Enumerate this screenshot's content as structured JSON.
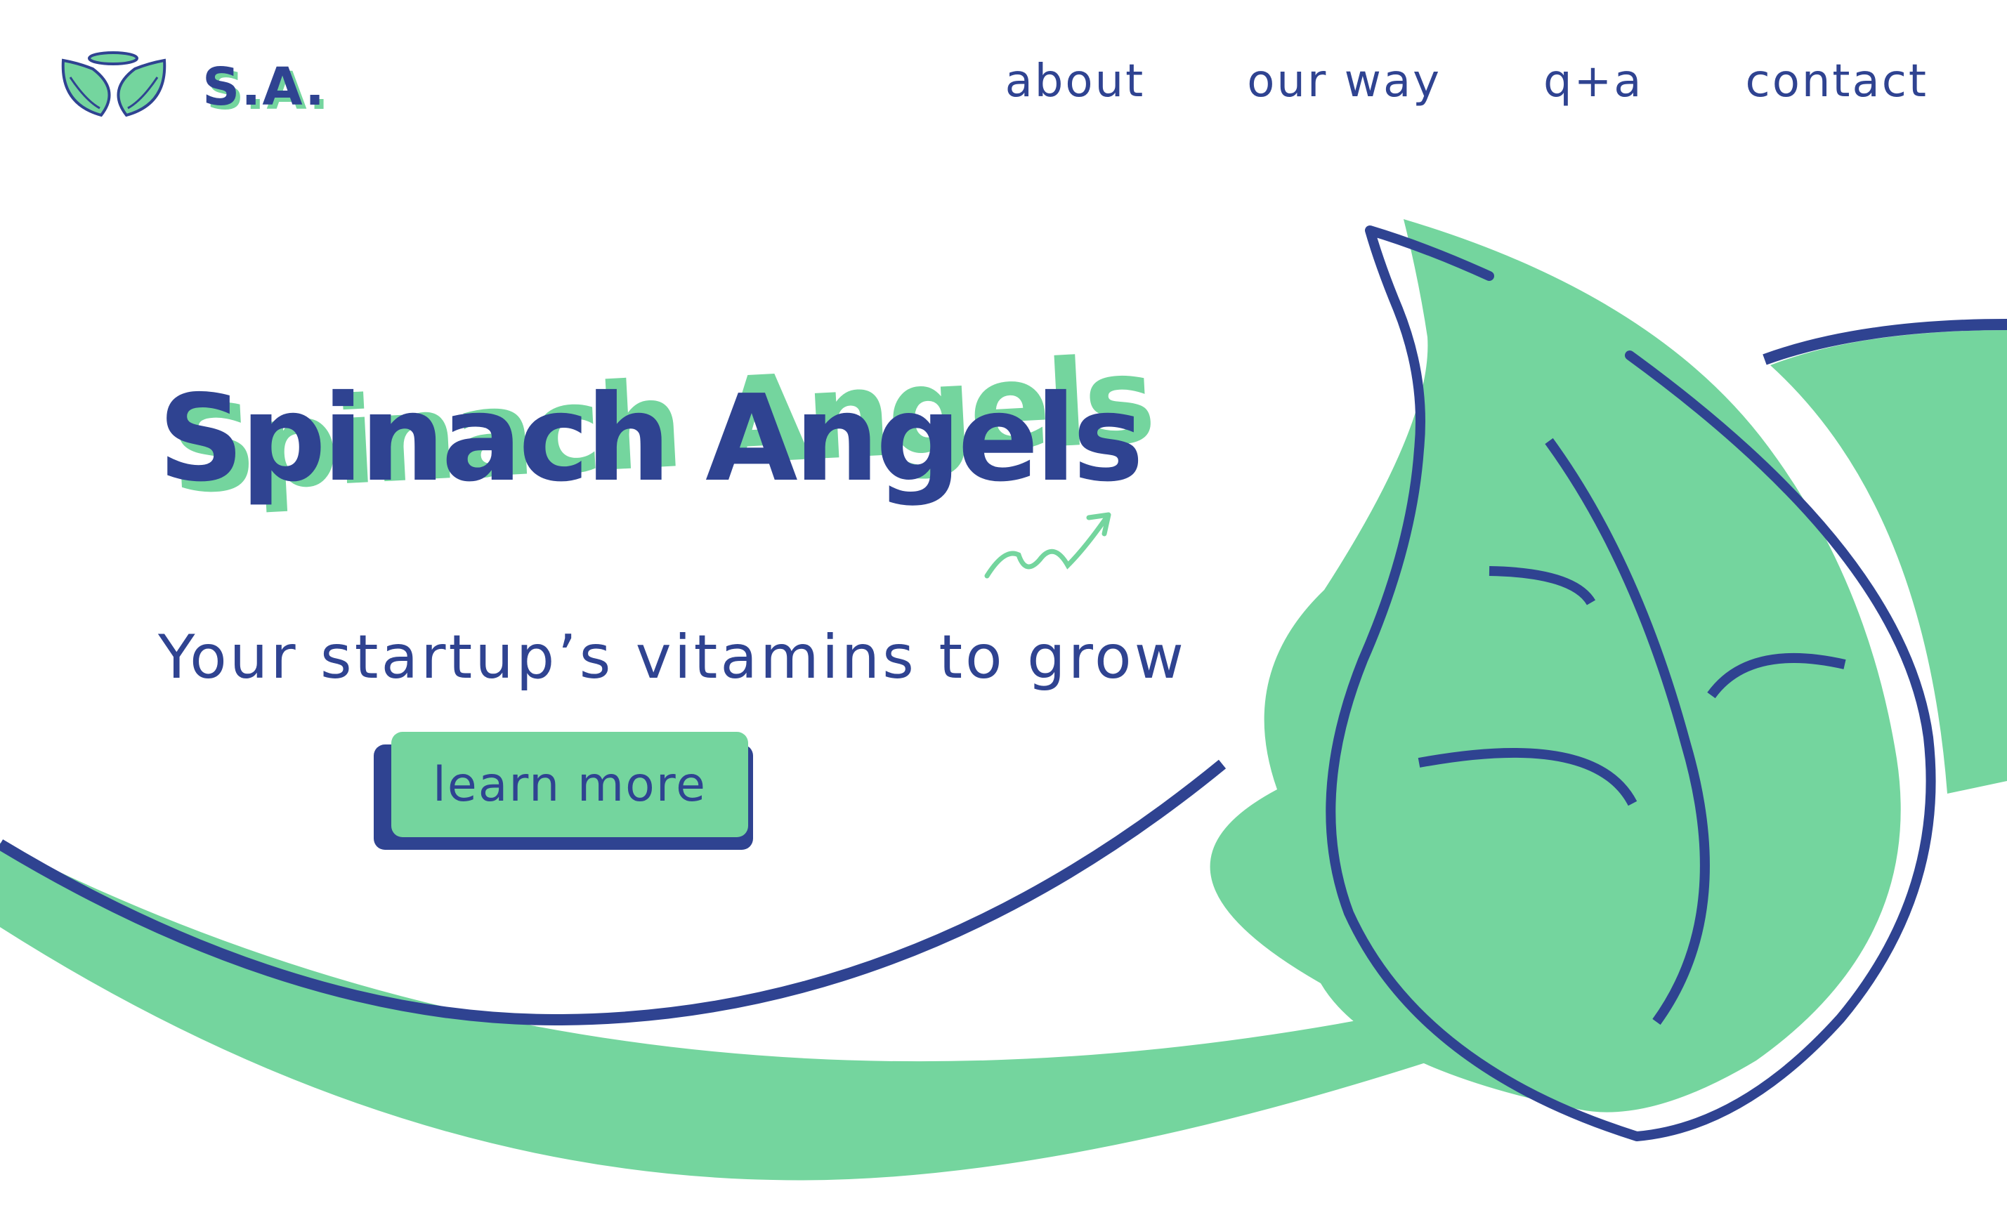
{
  "brand": {
    "name": "S.A.",
    "logo_icon": "angel-leaves-icon"
  },
  "nav": {
    "items": [
      "about",
      "our way",
      "q+a",
      "contact"
    ]
  },
  "hero": {
    "title": "Spinach Angels",
    "tagline": "Your startup’s vitamins to grow",
    "cta_label": "learn more",
    "arrow_icon": "growth-arrow-icon",
    "illustration": "spinach-leaf-illustration"
  },
  "colors": {
    "primary": "#2f4391",
    "accent": "#74d59e",
    "background": "#ffffff"
  }
}
